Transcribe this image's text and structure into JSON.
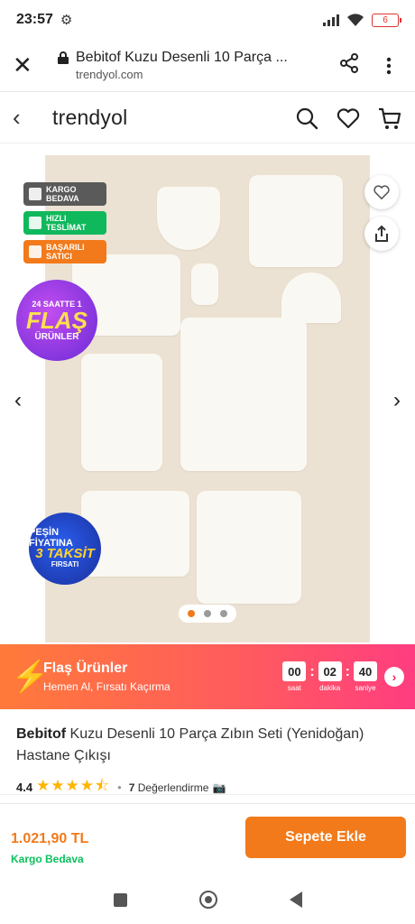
{
  "status_bar": {
    "time": "23:57",
    "battery": "6"
  },
  "browser": {
    "title": "Bebitof Kuzu Desenli 10 Parça ...",
    "domain": "trendyol.com"
  },
  "site": {
    "logo": "trendyol"
  },
  "badges": [
    {
      "label": "KARGO BEDAVA",
      "color": "#5a5a5a"
    },
    {
      "label": "HIZLI TESLİMAT",
      "color": "#10b85c"
    },
    {
      "label": "BAŞARILI SATICI",
      "color": "#f27a1a"
    }
  ],
  "flash_circle": {
    "line1": "24 SAATTE 1",
    "line2": "FLAŞ",
    "line3": "ÜRÜNLER"
  },
  "pesin_circle": {
    "line1": "PEŞİN FİYATINA",
    "line2": "3 TAKSİT",
    "line3": "FIRSATI"
  },
  "carousel": {
    "count": 3,
    "active": 0
  },
  "flash_banner": {
    "title": "Flaş Ürünler",
    "subtitle": "Hemen Al, Fırsatı Kaçırma",
    "hours": "00",
    "hours_label": "saat",
    "minutes": "02",
    "minutes_label": "dakika",
    "seconds": "40",
    "seconds_label": "saniye"
  },
  "product": {
    "brand": "Bebitof",
    "name": " Kuzu Desenli 10 Parça  Zıbın Seti (Yenidoğan) Hastane Çıkışı",
    "rating": "4.4",
    "stars": "★★★★⯪",
    "review_count": "7",
    "review_label": " Değerlendirme"
  },
  "buy_bar": {
    "price": "1.021,90 TL",
    "shipping": "Kargo Bedava",
    "button": "Sepete Ekle"
  },
  "colors": {
    "brand_orange": "#f27a1a",
    "green": "#0bc15c"
  }
}
